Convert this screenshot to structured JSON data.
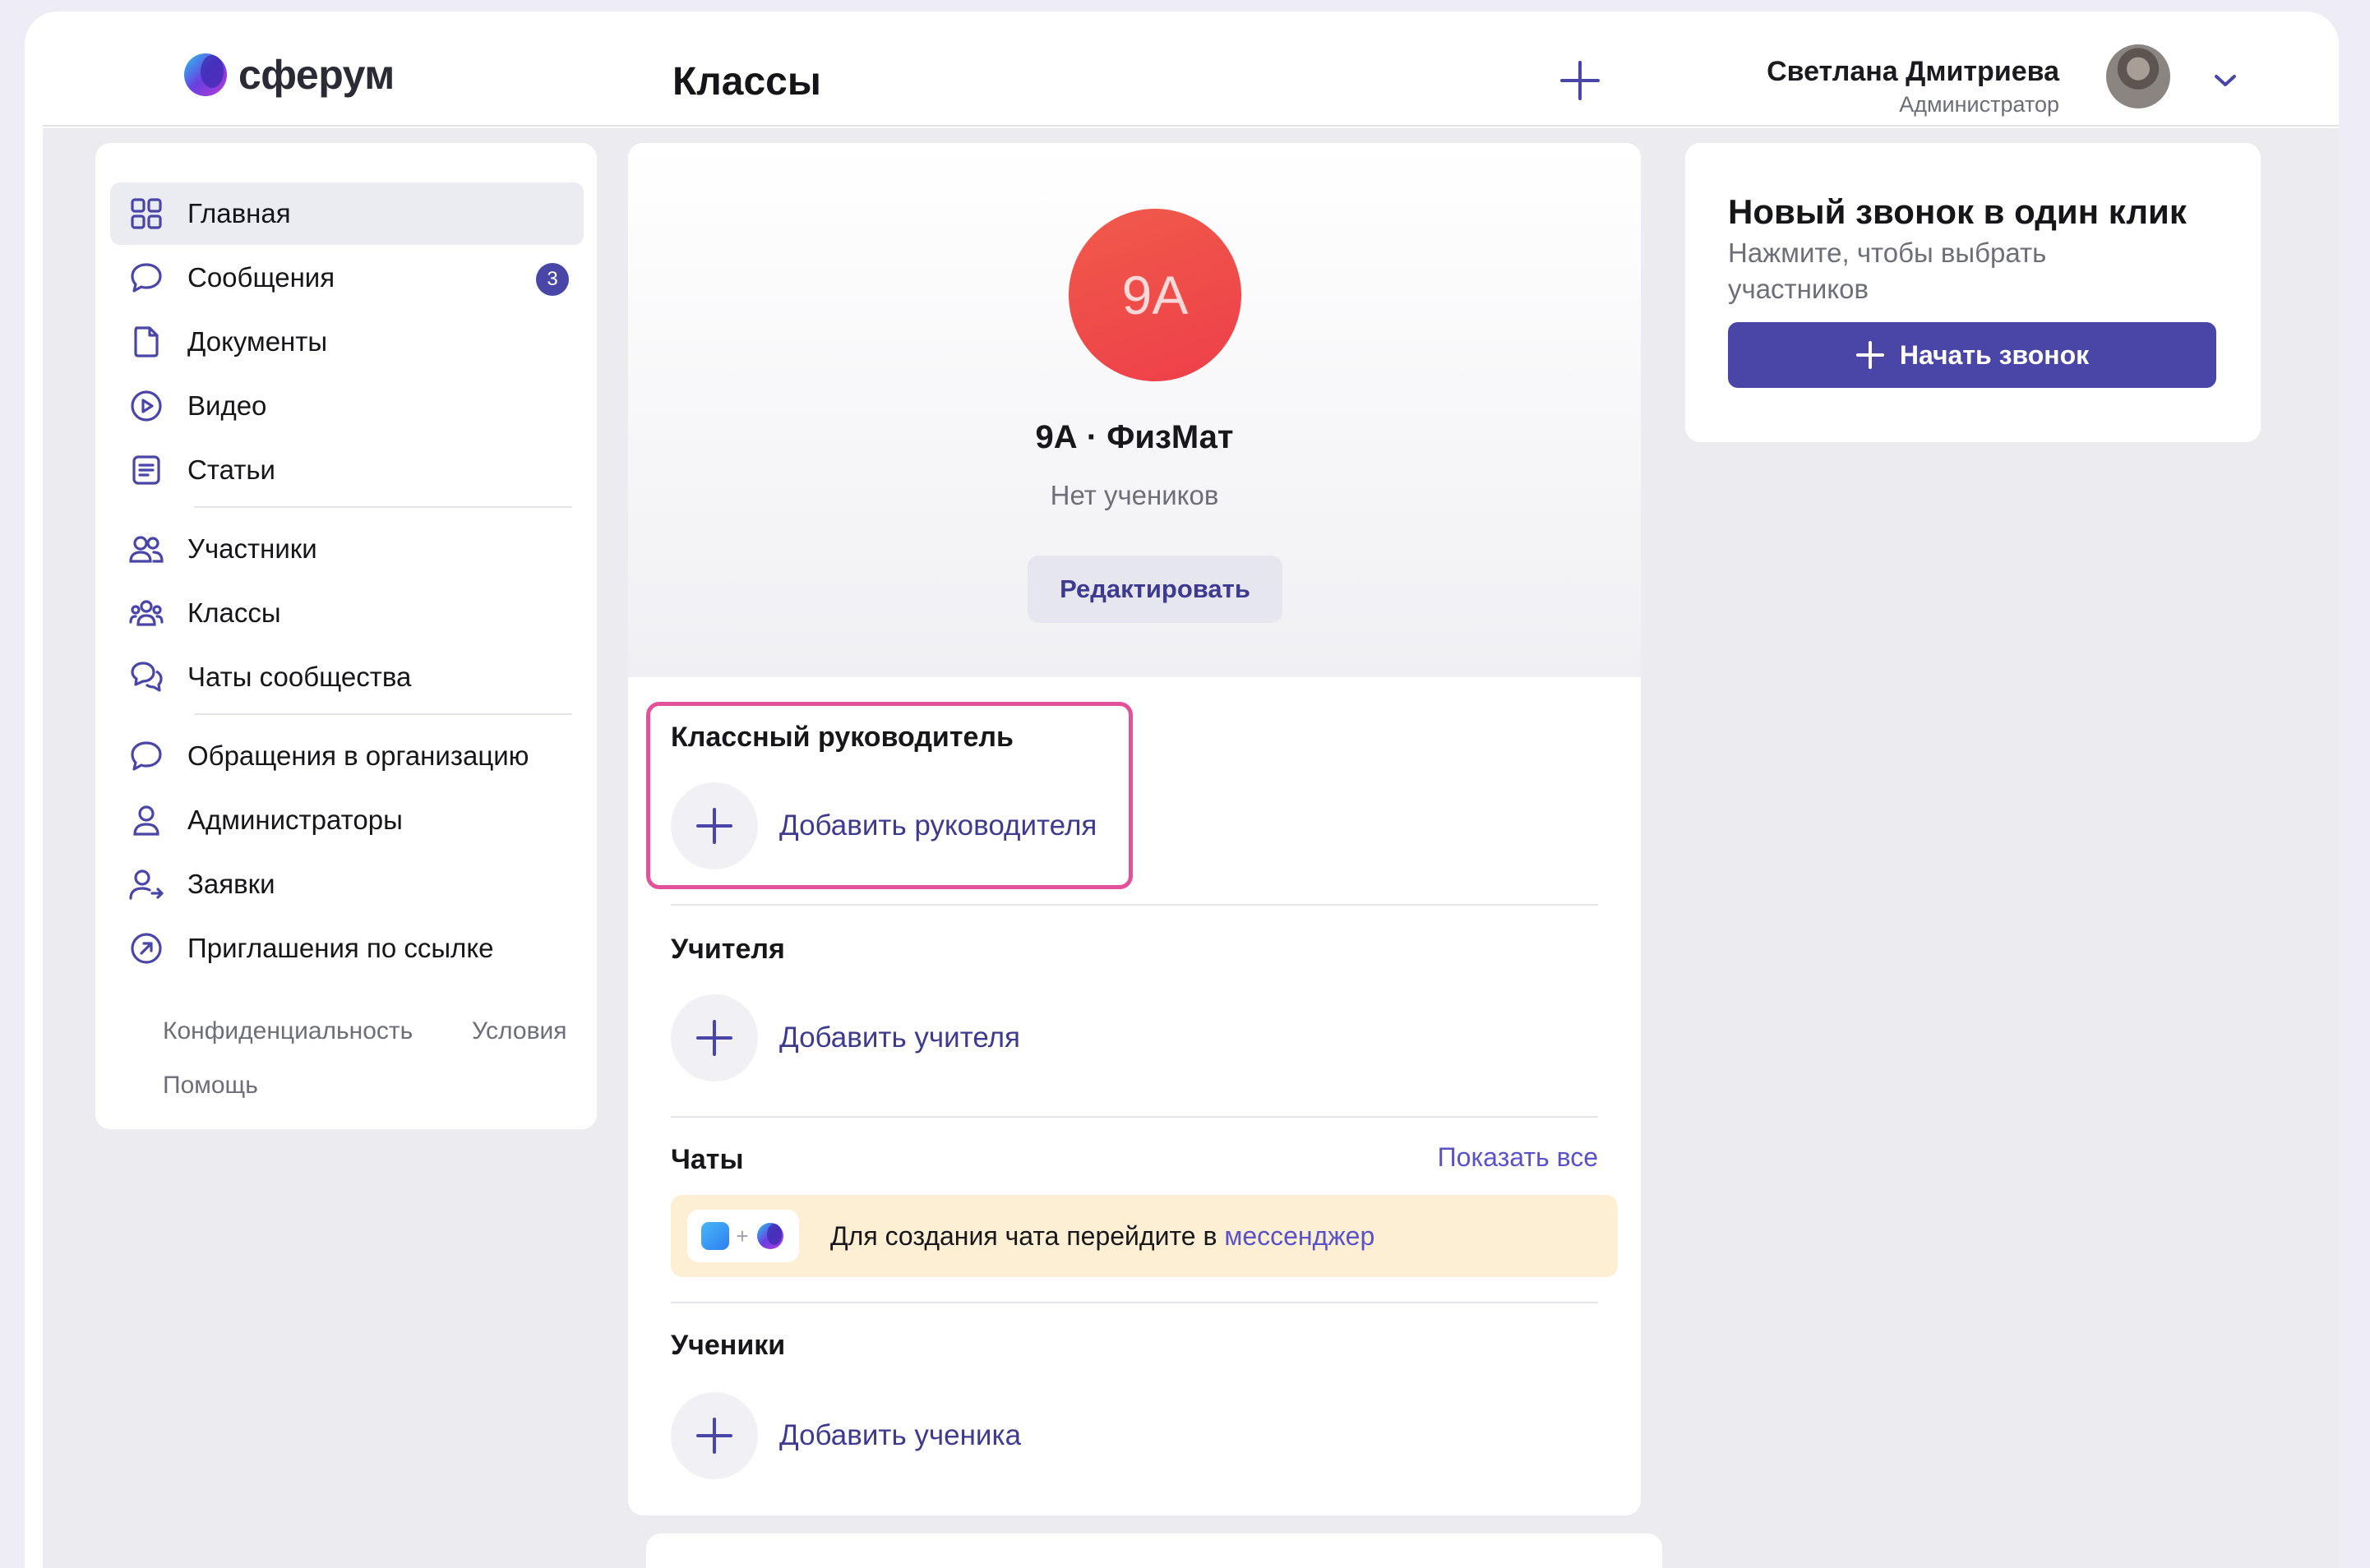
{
  "app": {
    "logo_text": "сферум",
    "page_title": "Классы"
  },
  "user": {
    "name": "Светлана Дмитриева",
    "role": "Администратор"
  },
  "sidebar": {
    "items": [
      {
        "label": "Главная",
        "icon": "grid-icon",
        "active": true
      },
      {
        "label": "Сообщения",
        "icon": "chat-bubble-icon",
        "badge": "3"
      },
      {
        "label": "Документы",
        "icon": "document-icon"
      },
      {
        "label": "Видео",
        "icon": "play-icon"
      },
      {
        "label": "Статьи",
        "icon": "article-icon"
      },
      {
        "label": "Участники",
        "icon": "users-icon"
      },
      {
        "label": "Классы",
        "icon": "class-group-icon"
      },
      {
        "label": "Чаты сообщества",
        "icon": "chats-icon"
      },
      {
        "label": "Обращения в организацию",
        "icon": "chat-bubble-icon"
      },
      {
        "label": "Администраторы",
        "icon": "person-icon"
      },
      {
        "label": "Заявки",
        "icon": "person-arrow-icon"
      },
      {
        "label": "Приглашения по ссылке",
        "icon": "link-arrow-icon"
      }
    ],
    "footer": {
      "privacy": "Конфиденциальность",
      "terms": "Условия",
      "help": "Помощь"
    }
  },
  "class_card": {
    "avatar_text": "9А",
    "title": "9А · ФизМат",
    "subtitle": "Нет учеников",
    "edit_label": "Редактировать",
    "sections": {
      "head_teacher": {
        "title": "Классный руководитель",
        "add_label": "Добавить руководителя"
      },
      "teachers": {
        "title": "Учителя",
        "add_label": "Добавить учителя"
      },
      "chats": {
        "title": "Чаты",
        "show_all": "Показать все",
        "banner_text": "Для создания чата перейдите в ",
        "banner_link": "мессенджер"
      },
      "students": {
        "title": "Ученики",
        "add_label": "Добавить ученика"
      }
    }
  },
  "call_card": {
    "title": "Новый звонок в один клик",
    "subtitle": "Нажмите, чтобы выбрать участников",
    "button_label": "Начать звонок"
  },
  "colors": {
    "accent": "#4a46a8",
    "link": "#5a52c8",
    "highlight": "#e2519a",
    "class_avatar": "#ef4a4a",
    "banner": "#fdefd3"
  }
}
